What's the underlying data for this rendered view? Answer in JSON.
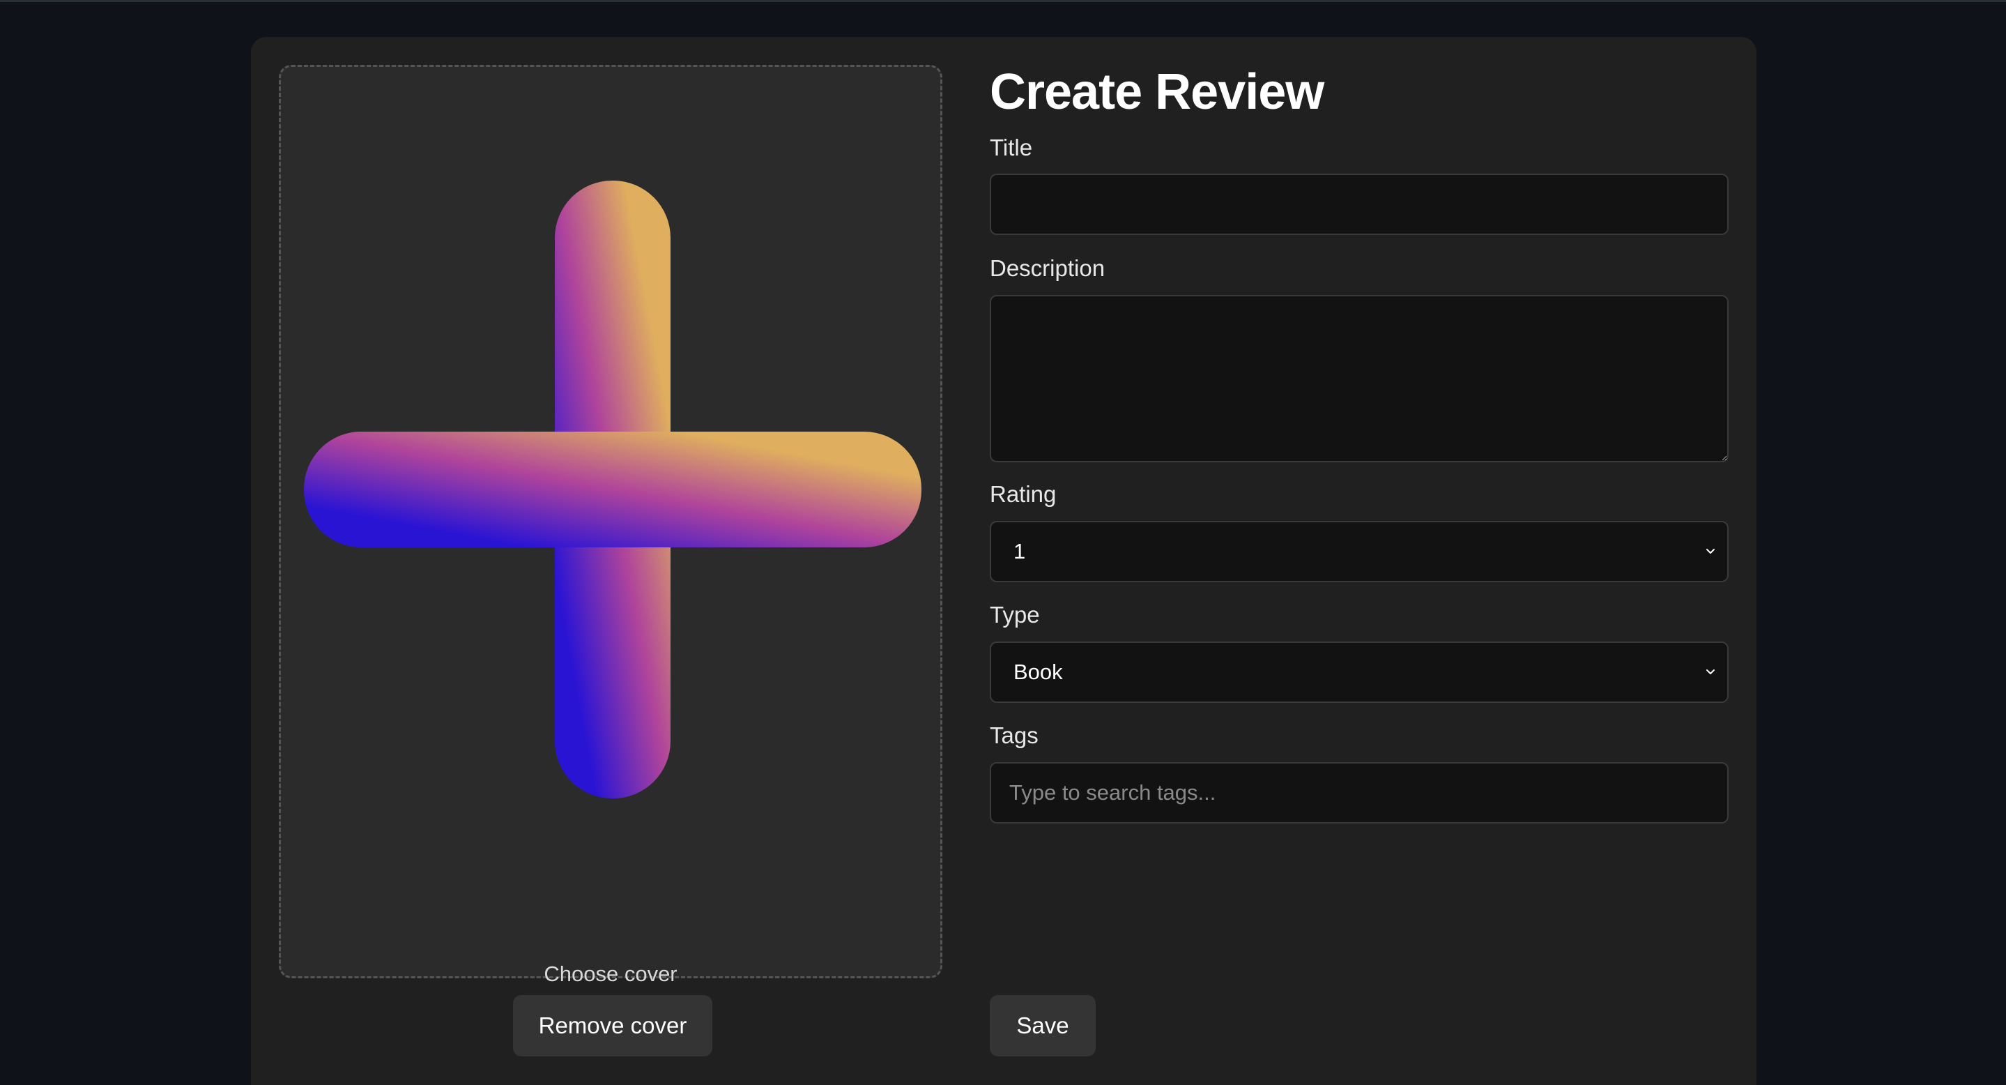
{
  "cover": {
    "choose_label": "Choose cover",
    "remove_label": "Remove cover",
    "plus_gradient": [
      "#2a14d4",
      "#b0449b",
      "#dfae5e"
    ]
  },
  "form": {
    "heading": "Create Review",
    "title_label": "Title",
    "title_value": "",
    "description_label": "Description",
    "description_value": "",
    "rating_label": "Rating",
    "rating_value": "1",
    "type_label": "Type",
    "type_value": "Book",
    "tags_label": "Tags",
    "tags_placeholder": "Type to search tags...",
    "save_label": "Save"
  }
}
